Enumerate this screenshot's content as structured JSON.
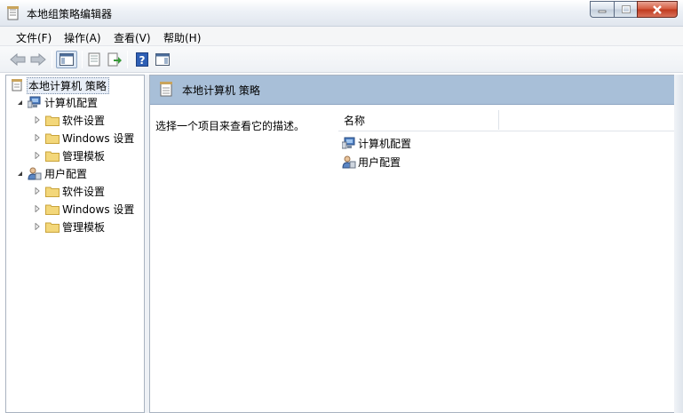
{
  "window": {
    "title": "本地组策略编辑器",
    "icon": "policy-document-icon"
  },
  "menu": {
    "items": [
      {
        "label": "文件(F)"
      },
      {
        "label": "操作(A)"
      },
      {
        "label": "查看(V)"
      },
      {
        "label": "帮助(H)"
      }
    ]
  },
  "toolbar": {
    "icons": [
      "back-arrow-icon",
      "forward-arrow-icon",
      "show-hide-tree-icon",
      "properties-icon",
      "export-list-icon",
      "help-icon",
      "show-hide-action-pane-icon"
    ]
  },
  "tree": {
    "root": "本地计算机 策略",
    "computer": {
      "label": "计算机配置",
      "children": [
        "软件设置",
        "Windows 设置",
        "管理模板"
      ]
    },
    "user": {
      "label": "用户配置",
      "children": [
        "软件设置",
        "Windows 设置",
        "管理模板"
      ]
    }
  },
  "content": {
    "header_title": "本地计算机 策略",
    "description": "选择一个项目来查看它的描述。",
    "column_name": "名称",
    "rows": [
      {
        "label": "计算机配置",
        "icon": "computer-config-icon"
      },
      {
        "label": "用户配置",
        "icon": "user-config-icon"
      }
    ]
  },
  "colors": {
    "header_bg": "#a8bfd8",
    "folder": "#f3d77a",
    "close_button": "#c0391d"
  }
}
